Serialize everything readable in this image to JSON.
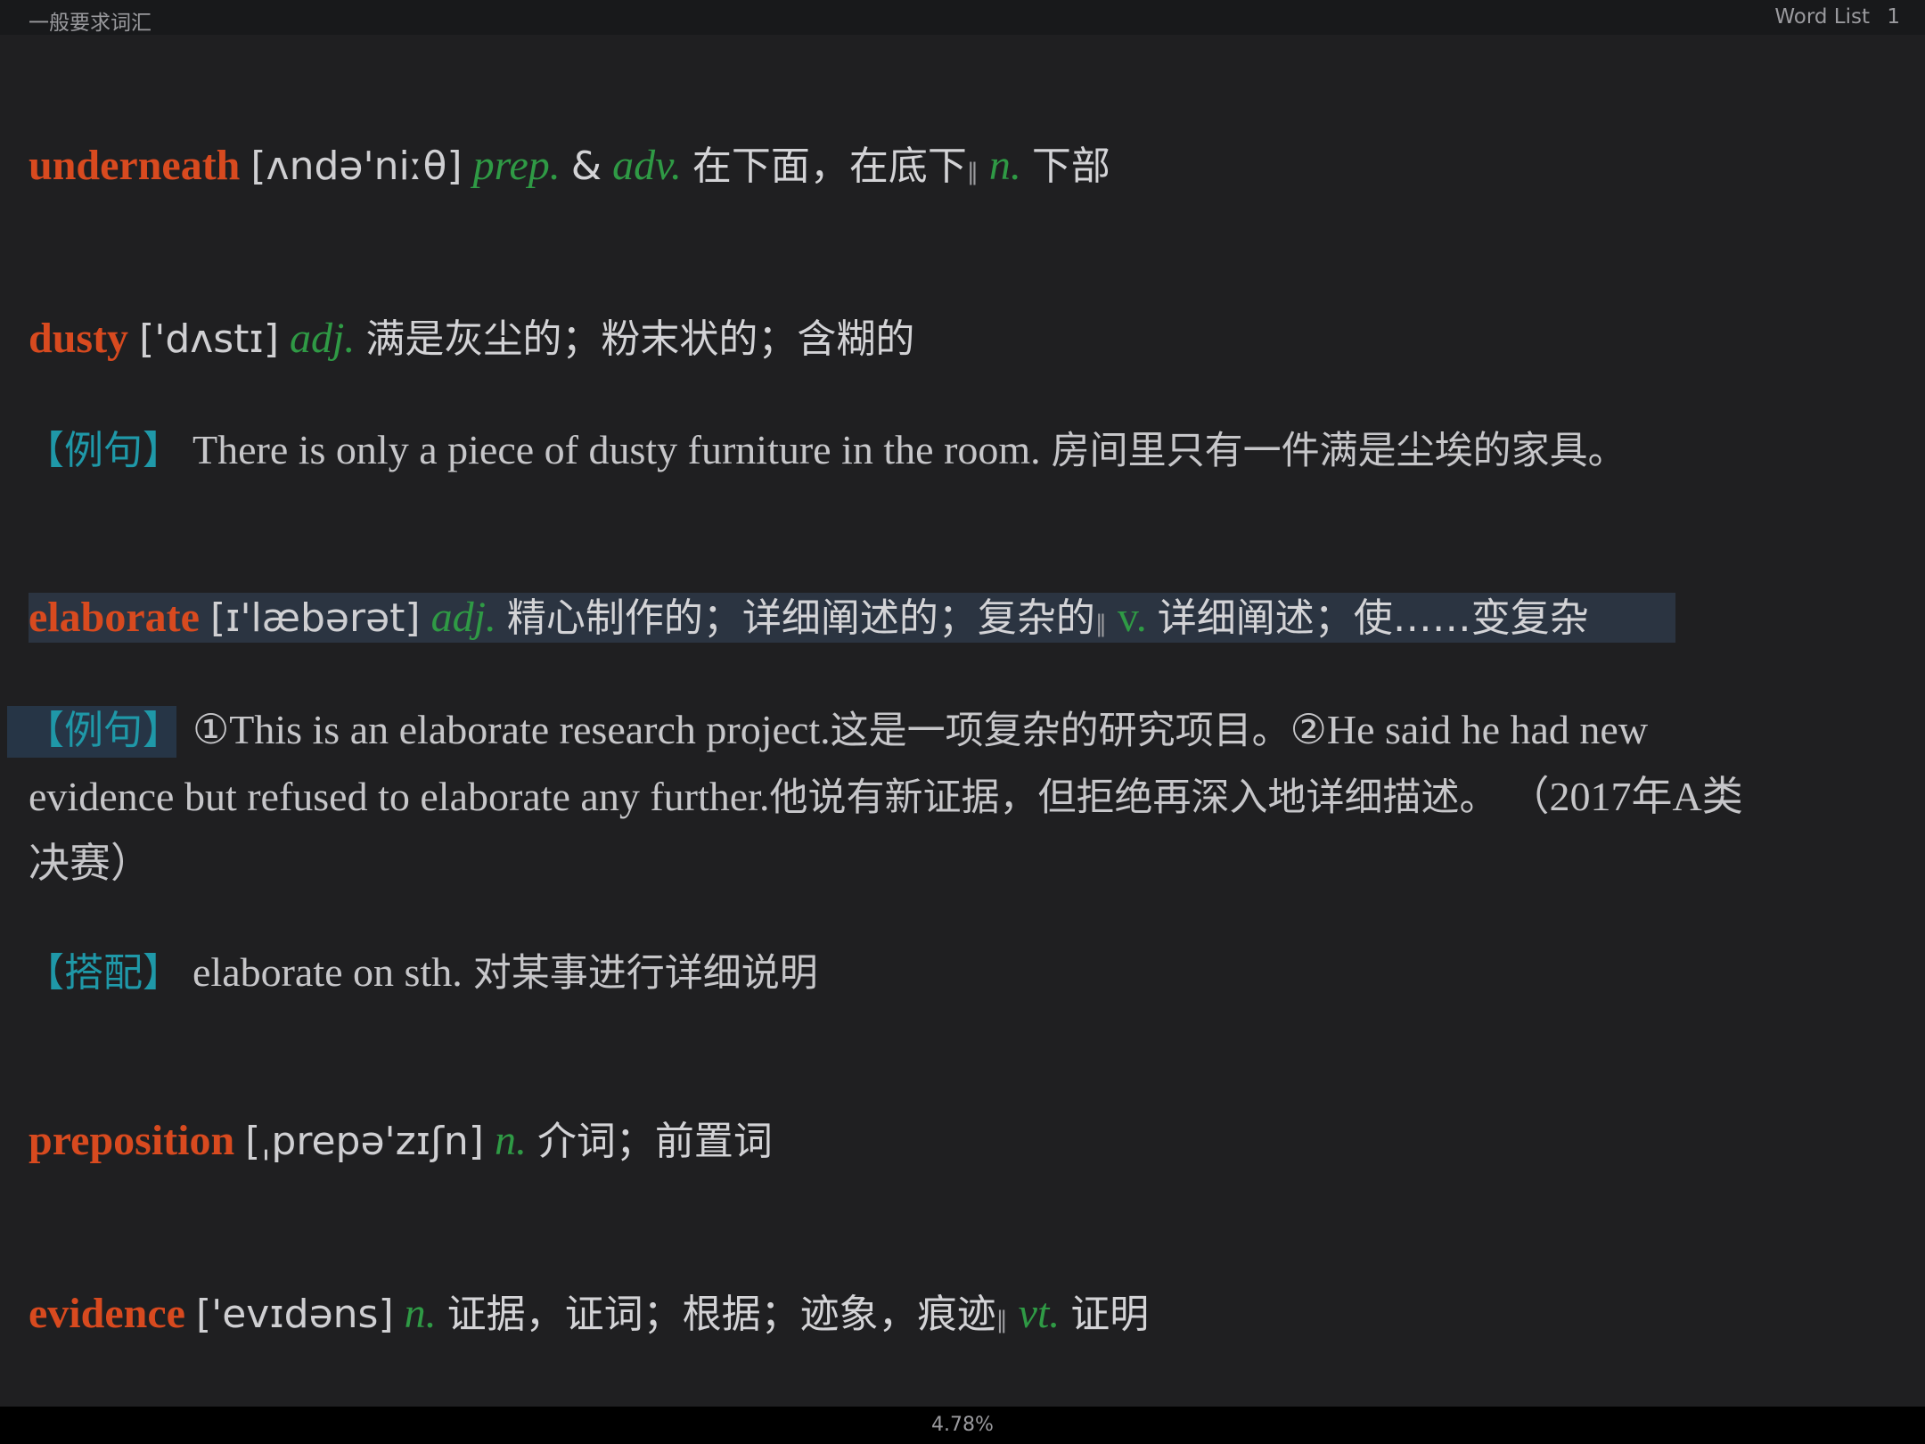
{
  "header": {
    "book_title": "一般要求词汇",
    "chapter": "Word List",
    "page": "1"
  },
  "entries": {
    "underneath": {
      "word": "underneath",
      "phonetic": "[ʌndə'niːθ]",
      "pos1": "prep.",
      "amp": "&",
      "pos2": "adv.",
      "def1": "在下面，在底下",
      "sep": "‖",
      "pos3": "n.",
      "def2": "下部"
    },
    "dusty": {
      "word": "dusty",
      "phonetic": "['dʌstɪ]",
      "pos": "adj.",
      "def": "满是灰尘的；粉末状的；含糊的",
      "example_tag": "【例句】",
      "example_en": "There is only a piece of dusty furniture in the room.",
      "example_zh": "房间里只有一件满是尘埃的家具。"
    },
    "elaborate": {
      "word": "elaborate",
      "phonetic": "[ɪ'læbərət]",
      "pos1": "adj.",
      "def1": "精心制作的；详细阐述的；复杂的",
      "sep": "‖",
      "pos2": "v.",
      "def2": "详细阐述；使……变复杂",
      "example_tag": "【例句】",
      "example_num1": "①",
      "example1_en": "This is an elaborate research project.",
      "example1_zh": "这是一项复杂的研究项目。",
      "example_num2": "②",
      "example2_en_a": "He said he had new",
      "example2_en_b": "evidence but refused to elaborate any further.",
      "example2_zh": "他说有新证据，但拒绝再深入地详细描述。",
      "source_a": "（2017年A类",
      "source_b": "决赛）",
      "collocation_tag": "【搭配】",
      "collocation_en": "elaborate on sth.",
      "collocation_zh": "对某事进行详细说明"
    },
    "preposition": {
      "word": "preposition",
      "phonetic": "[ˌprepə'zɪʃn]",
      "pos": "n.",
      "def": "介词；前置词"
    },
    "evidence": {
      "word": "evidence",
      "phonetic": "['evɪdəns]",
      "pos1": "n.",
      "def1": "证据，证词；根据；迹象，痕迹",
      "sep": "‖",
      "pos2": "vt.",
      "def2": "证明"
    }
  },
  "footer": {
    "progress": "4.78%"
  }
}
